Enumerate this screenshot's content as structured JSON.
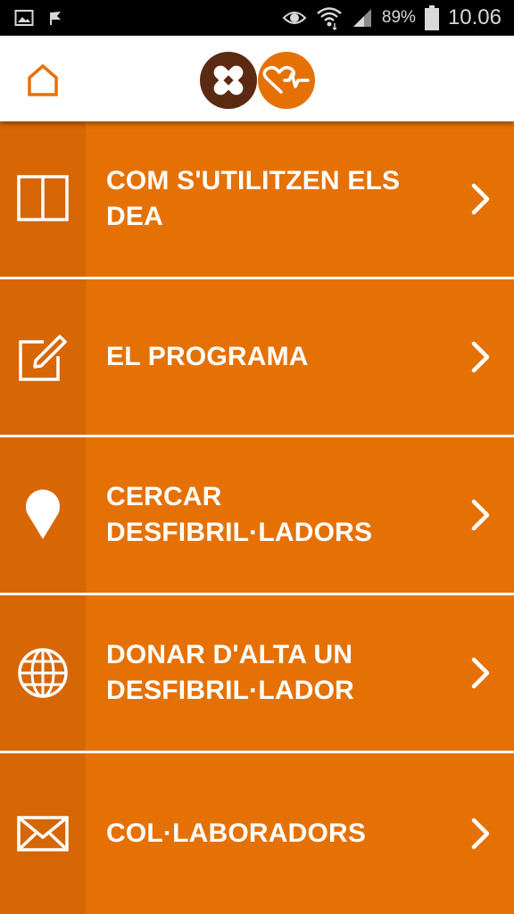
{
  "status_bar": {
    "battery_percent": "89%",
    "time": "10.06",
    "icons": [
      "image-icon",
      "flag-icon",
      "eye-icon",
      "wifi-icon",
      "signal-icon",
      "battery-icon"
    ]
  },
  "header": {
    "home_icon": "home-icon",
    "logo_icons": [
      "bandage-icon",
      "heartbeat-icon"
    ]
  },
  "colors": {
    "accent": "#e57105",
    "accent_dark": "#d76604",
    "logo_brown": "#5a2a12",
    "logo_orange": "#e57105"
  },
  "menu": {
    "items": [
      {
        "label": "COM S'UTILITZEN ELS DEA",
        "icon": "book-icon"
      },
      {
        "label": "EL PROGRAMA",
        "icon": "edit-icon"
      },
      {
        "label": "CERCAR DESFIBRIL·LADORS",
        "icon": "map-pin-icon"
      },
      {
        "label": "DONAR D'ALTA UN DESFIBRIL·LADOR",
        "icon": "globe-icon"
      },
      {
        "label": "COL·LABORADORS",
        "icon": "mail-icon"
      }
    ]
  }
}
